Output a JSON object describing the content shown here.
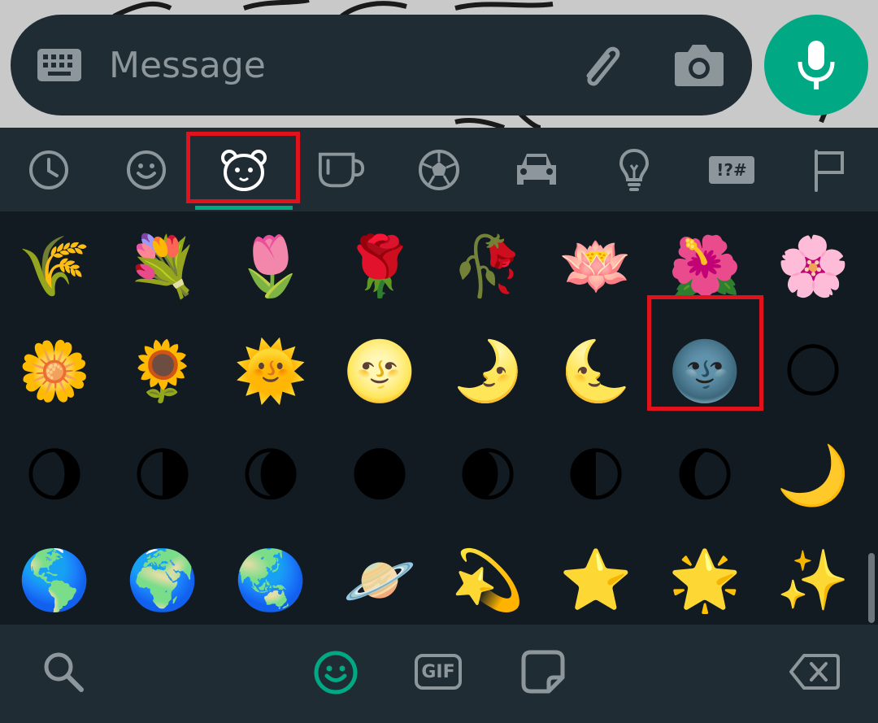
{
  "message_input": {
    "placeholder": "Message"
  },
  "emoji_categories": [
    {
      "name": "recent",
      "icon": "clock-icon"
    },
    {
      "name": "smileys",
      "icon": "smiley-icon"
    },
    {
      "name": "animals-nature",
      "icon": "bear-icon",
      "selected": true
    },
    {
      "name": "food",
      "icon": "cup-icon"
    },
    {
      "name": "activities",
      "icon": "soccer-ball-icon"
    },
    {
      "name": "travel",
      "icon": "car-icon"
    },
    {
      "name": "objects",
      "icon": "lightbulb-icon"
    },
    {
      "name": "symbols",
      "icon": "symbols-icon",
      "label": "!?#"
    },
    {
      "name": "flags",
      "icon": "flag-icon"
    }
  ],
  "emoji_rows": [
    [
      "🌾",
      "💐",
      "🌷",
      "🌹",
      "🥀",
      "🪷",
      "🌺",
      "🌸"
    ],
    [
      "🌼",
      "🌻",
      "🌞",
      "🌝",
      "🌛",
      "🌜",
      "🌚",
      "🌕"
    ],
    [
      "🌖",
      "🌗",
      "🌘",
      "🌑",
      "🌒",
      "🌓",
      "🌔",
      "🌙"
    ],
    [
      "🌎",
      "🌍",
      "🌏",
      "🪐",
      "💫",
      "⭐",
      "🌟",
      "✨"
    ],
    [
      "⚡",
      "🖼",
      "💥",
      "🔥",
      "🌪",
      "🌈",
      "☀",
      "🌤"
    ]
  ],
  "highlighted_emoji": "🌚",
  "bottom_bar": {
    "search_icon": "search-icon",
    "emoji_tab_icon": "smiley-icon",
    "gif_label": "GIF",
    "sticker_icon": "sticker-icon",
    "backspace_icon": "backspace-icon"
  },
  "colors": {
    "accent": "#00a884",
    "panel": "#1f2c34",
    "grid_bg": "#121b22",
    "icon": "#8d969b",
    "highlight": "#e0121b"
  }
}
